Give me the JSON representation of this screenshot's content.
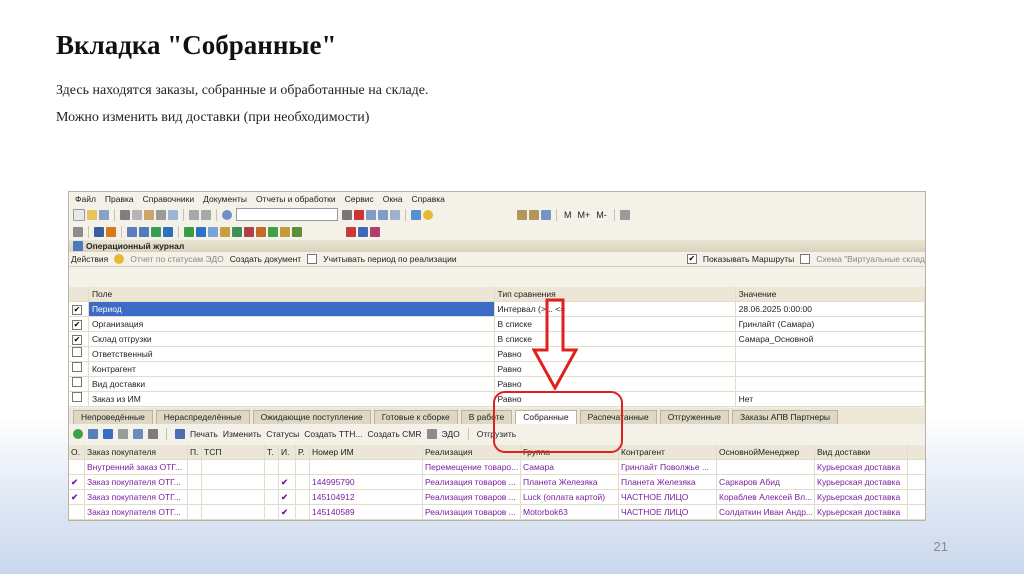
{
  "slide": {
    "title": "Вкладка \"Собранные\"",
    "para1": "Здесь находятся заказы, собранные и обработанные на складе.",
    "para2": "Можно изменить вид доставки (при необходимости)",
    "page": "21"
  },
  "app": {
    "menu": [
      "Файл",
      "Правка",
      "Справочники",
      "Документы",
      "Отчеты и обработки",
      "Сервис",
      "Окна",
      "Справка"
    ],
    "m_labels": [
      "M",
      "M+",
      "M-"
    ],
    "window_title": "Операционный журнал",
    "actions": {
      "actions": "Действия",
      "report": "Отчет по статусам ЭДО",
      "create": "Создать документ",
      "period_chk": "Учитывать период по реализации",
      "show_routes": "Показывать Маршруты",
      "scheme": "Схема \"Виртуальные склад"
    },
    "filter_headers": [
      "Поле",
      "Тип сравнения",
      "Значение"
    ],
    "filters": [
      {
        "checked": "✔",
        "field": "Период",
        "cmp": "Интервал (>... <=",
        "val": "28.06.2025 0:00:00"
      },
      {
        "checked": "✔",
        "field": "Организация",
        "cmp": "В списке",
        "val": "Гринлайт (Самара)"
      },
      {
        "checked": "✔",
        "field": "Склад отгрузки",
        "cmp": "В списке",
        "val": "Самара_Основной"
      },
      {
        "checked": "",
        "field": "Ответственный",
        "cmp": "Равно",
        "val": ""
      },
      {
        "checked": "",
        "field": "Контрагент",
        "cmp": "Равно",
        "val": ""
      },
      {
        "checked": "",
        "field": "Вид доставки",
        "cmp": "Равно",
        "val": ""
      },
      {
        "checked": "",
        "field": "Заказ из ИМ",
        "cmp": "Равно",
        "val": "Нет"
      }
    ],
    "tabs": [
      "Непроведённые",
      "Нераспределённые",
      "Ожидающие поступление",
      "Готовые к сборке",
      "В работе",
      "Собранные",
      "Распечатанные",
      "Отгруженные",
      "Заказы АПВ Партнеры"
    ],
    "doc_toolbar": [
      "Печать",
      "Изменить",
      "Статусы",
      "Создать ТТН...",
      "Создать CMR",
      "ЭДО",
      "Отгрузить"
    ],
    "doc_headers": [
      "О.",
      "Заказ покупателя",
      "П.",
      "ТСП",
      "Т.",
      "И.",
      "Р.",
      "Номер ИМ",
      "Реализация",
      "Группа",
      "Контрагент",
      "ОсновнойМенеджер",
      "Вид доставки"
    ],
    "docs": [
      {
        "o": "",
        "order": "Внутренний заказ ОТГ...",
        "p": "",
        "tsp": "",
        "t": "",
        "i": "",
        "r": "",
        "num": "",
        "real": "Перемещение товаро...",
        "group": "Самара",
        "contr": "Гринлайт Поволжье ...",
        "mgr": "",
        "dlv": "Курьерская доставка"
      },
      {
        "o": "✔",
        "order": "Заказ покупателя ОТГ...",
        "p": "",
        "tsp": "",
        "t": "",
        "i": "✔",
        "r": "",
        "num": "144995790",
        "real": "Реализация товаров ...",
        "group": "Планета Железяка",
        "contr": "Планета Железяка",
        "mgr": "Саркаров Абид",
        "dlv": "Курьерская доставка"
      },
      {
        "o": "✔",
        "order": "Заказ покупателя ОТГ...",
        "p": "",
        "tsp": "",
        "t": "",
        "i": "✔",
        "r": "",
        "num": "145104912",
        "real": "Реализация товаров ...",
        "group": "Luck (оплата картой)",
        "contr": "ЧАСТНОЕ ЛИЦО",
        "mgr": "Кораблев Алексей Вл...",
        "dlv": "Курьерская доставка"
      },
      {
        "o": "",
        "order": "Заказ покупателя ОТГ...",
        "p": "",
        "tsp": "",
        "t": "",
        "i": "✔",
        "r": "",
        "num": "145140589",
        "real": "Реализация товаров ...",
        "group": "Motorbok63",
        "contr": "ЧАСТНОЕ ЛИЦО",
        "mgr": "Солдаткин Иван Андр...",
        "dlv": "Курьерская доставка"
      }
    ],
    "colors": {
      "highlight": "#e0201c",
      "selected": "#3c6cc5",
      "purple_text": "#7a1f9c"
    }
  }
}
